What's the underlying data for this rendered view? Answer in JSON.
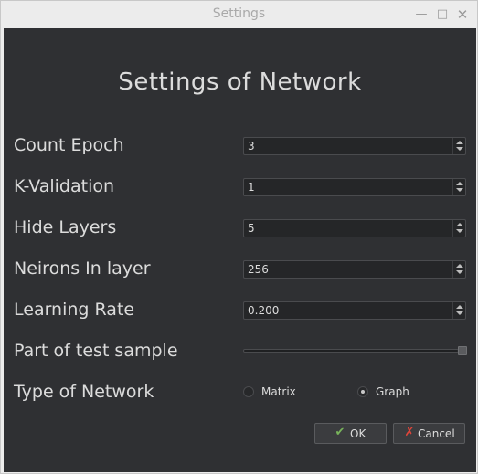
{
  "window": {
    "title": "Settings"
  },
  "heading": "Settings of Network",
  "fields": {
    "count_epoch": {
      "label": "Count Epoch",
      "value": "3"
    },
    "k_validation": {
      "label": "K-Validation",
      "value": "1"
    },
    "hide_layers": {
      "label": "Hide Layers",
      "value": "5"
    },
    "neirons_in_layer": {
      "label": "Neirons In layer",
      "value": "256"
    },
    "learning_rate": {
      "label": "Learning Rate",
      "value": "0.200"
    },
    "part_of_test_sample": {
      "label": "Part of test sample",
      "slider_fraction": 1.0
    },
    "type_of_network": {
      "label": "Type of Network",
      "options": [
        "Matrix",
        "Graph"
      ],
      "selected": "Graph"
    }
  },
  "buttons": {
    "ok": "OK",
    "cancel": "Cancel"
  },
  "icons": {
    "minimize": "minimize-icon",
    "maximize": "maximize-icon",
    "close": "close-icon",
    "ok": "ok-check-icon",
    "cancel": "cancel-x-icon"
  },
  "colors": {
    "content_bg": "#2f3033",
    "text": "#dcdcdc",
    "titlebar_bg": "#ececec",
    "ok_icon": "#78b35b",
    "cancel_icon": "#e0453a"
  }
}
